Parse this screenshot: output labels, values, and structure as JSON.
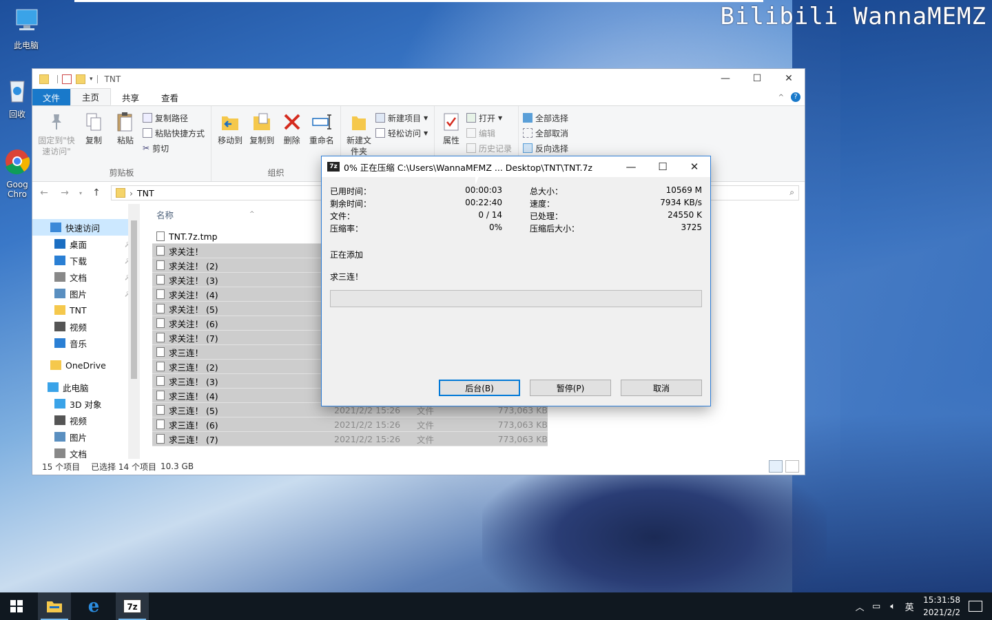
{
  "watermark": "Bilibili WannaMEMZ",
  "desktop": {
    "icons": [
      {
        "label": "此电脑"
      },
      {
        "label": "回收"
      },
      {
        "label": "Goog Chro"
      }
    ]
  },
  "explorer": {
    "title": "TNT",
    "tabs": [
      "文件",
      "主页",
      "共享",
      "查看"
    ],
    "ribbon": {
      "clipboard": {
        "label": "剪贴板",
        "pin": "固定到\"快速访问\"",
        "copy": "复制",
        "paste": "粘贴",
        "copy_path": "复制路径",
        "paste_shortcut": "粘贴快捷方式",
        "cut": "剪切"
      },
      "organize": {
        "label": "组织",
        "move_to": "移动到",
        "copy_to": "复制到",
        "delete": "删除",
        "rename": "重命名"
      },
      "new": {
        "new_folder": "新建文件夹",
        "new_item": "新建项目",
        "easy_access": "轻松访问"
      },
      "open": {
        "properties": "属性",
        "open": "打开",
        "edit": "编辑",
        "history": "历史记录"
      },
      "select": {
        "select_all": "全部选择",
        "select_none": "全部取消",
        "invert": "反向选择"
      }
    },
    "address": {
      "path": "TNT"
    },
    "nav": [
      {
        "label": "快速访问",
        "sel": true
      },
      {
        "label": "桌面",
        "pin": true
      },
      {
        "label": "下载",
        "pin": true
      },
      {
        "label": "文档",
        "pin": true
      },
      {
        "label": "图片",
        "pin": true
      },
      {
        "label": "TNT"
      },
      {
        "label": "视频"
      },
      {
        "label": "音乐"
      },
      {
        "label": "OneDrive"
      },
      {
        "label": "此电脑"
      },
      {
        "label": "3D 对象"
      },
      {
        "label": "视频"
      },
      {
        "label": "图片"
      },
      {
        "label": "文档"
      }
    ],
    "columns": {
      "name": "名称"
    },
    "files": [
      {
        "name": "TNT.7z.tmp",
        "date": "",
        "type": "",
        "size": "",
        "sel": false
      },
      {
        "name": "求关注！",
        "date": "",
        "type": "",
        "size": "",
        "sel": true
      },
      {
        "name": "求关注！ (2)",
        "date": "",
        "type": "",
        "size": "",
        "sel": true
      },
      {
        "name": "求关注！ (3)",
        "date": "",
        "type": "",
        "size": "",
        "sel": true
      },
      {
        "name": "求关注！ (4)",
        "date": "",
        "type": "",
        "size": "",
        "sel": true
      },
      {
        "name": "求关注！ (5)",
        "date": "",
        "type": "",
        "size": "",
        "sel": true
      },
      {
        "name": "求关注！ (6)",
        "date": "",
        "type": "",
        "size": "",
        "sel": true
      },
      {
        "name": "求关注！ (7)",
        "date": "",
        "type": "",
        "size": "",
        "sel": true
      },
      {
        "name": "求三连！",
        "date": "",
        "type": "",
        "size": "",
        "sel": true
      },
      {
        "name": "求三连！ (2)",
        "date": "",
        "type": "",
        "size": "",
        "sel": true
      },
      {
        "name": "求三连！ (3)",
        "date": "",
        "type": "",
        "size": "",
        "sel": true
      },
      {
        "name": "求三连！ (4)",
        "date": "",
        "type": "",
        "size": "",
        "sel": true
      },
      {
        "name": "求三连！ (5)",
        "date": "2021/2/2 15:26",
        "type": "文件",
        "size": "773,063 KB",
        "sel": true
      },
      {
        "name": "求三连！ (6)",
        "date": "2021/2/2 15:26",
        "type": "文件",
        "size": "773,063 KB",
        "sel": true
      },
      {
        "name": "求三连！ (7)",
        "date": "2021/2/2 15:26",
        "type": "文件",
        "size": "773,063 KB",
        "sel": true
      }
    ],
    "status": {
      "count": "15 个项目",
      "selected": "已选择 14 个项目",
      "size": "10.3 GB"
    }
  },
  "dialog": {
    "title": "0% 正在压缩 C:\\Users\\WannaMEMZ ... Desktop\\TNT\\TNT.7z",
    "logo": "7z",
    "stats": {
      "elapsed_label": "已用时间：",
      "elapsed": "00:00:03",
      "remaining_label": "剩余时间：",
      "remaining": "00:22:40",
      "files_label": "文件：",
      "files": "0 / 14",
      "ratio_label": "压缩率：",
      "ratio": "0%",
      "total_label": "总大小：",
      "total": "10569 M",
      "speed_label": "速度：",
      "speed": "7934 KB/s",
      "processed_label": "已处理：",
      "processed": "24550 K",
      "packed_label": "压缩后大小：",
      "packed": "3725"
    },
    "status": "正在添加",
    "current_file": "求三连！",
    "progress": 0,
    "buttons": {
      "background": "后台(B)",
      "pause": "暂停(P)",
      "cancel": "取消"
    }
  },
  "taskbar": {
    "tray_lang": "英",
    "time": "15:31:58",
    "date": "2021/2/2",
    "app_7z": "7z"
  }
}
